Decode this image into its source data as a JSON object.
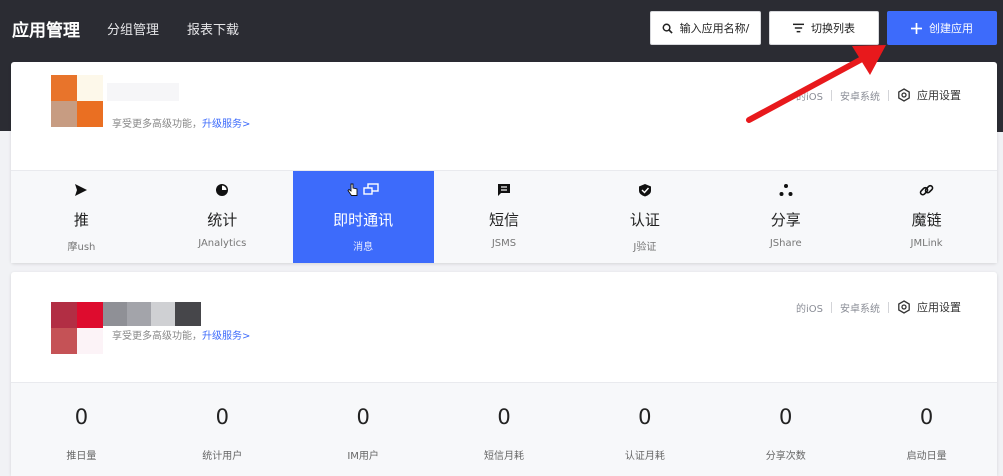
{
  "header": {
    "brand": "应用管理",
    "nav": [
      "分组管理",
      "报表下载"
    ],
    "search_placeholder": "输入应用名称/",
    "toggle_label": "切换列表",
    "create_label": "创建应用"
  },
  "colors": {
    "topbar": "#2b2c33",
    "accent": "#3d6bfb",
    "arrow": "#e8191c"
  },
  "apps": [
    {
      "upgrade_text": "享受更多高级功能，",
      "upgrade_link": "升级服务>",
      "platforms": [
        "的iOS",
        "安卓系统"
      ],
      "settings_label": "应用设置",
      "services": [
        {
          "icon": "send-icon",
          "title": "推",
          "sub": "摩ush"
        },
        {
          "icon": "pie-chart-icon",
          "title": "统计",
          "sub": "JAnalytics"
        },
        {
          "icon": "chat-icon",
          "title": "即时通讯",
          "sub": "消息",
          "active": true
        },
        {
          "icon": "message-icon",
          "title": "短信",
          "sub": "JSMS"
        },
        {
          "icon": "shield-check-icon",
          "title": "认证",
          "sub": "J验证"
        },
        {
          "icon": "share-icon",
          "title": "分享",
          "sub": "JShare"
        },
        {
          "icon": "link-icon",
          "title": "魔链",
          "sub": "JMLink"
        }
      ]
    },
    {
      "upgrade_text": "享受更多高级功能，",
      "upgrade_link": "升级服务>",
      "platforms": [
        "的iOS",
        "安卓系统"
      ],
      "settings_label": "应用设置",
      "stats": [
        {
          "value": "0",
          "label": "推日量"
        },
        {
          "value": "0",
          "label": "统计用户"
        },
        {
          "value": "0",
          "label": "IM用户"
        },
        {
          "value": "0",
          "label": "短信月耗"
        },
        {
          "value": "0",
          "label": "认证月耗"
        },
        {
          "value": "0",
          "label": "分享次数"
        },
        {
          "value": "0",
          "label": "启动日量"
        }
      ]
    }
  ]
}
